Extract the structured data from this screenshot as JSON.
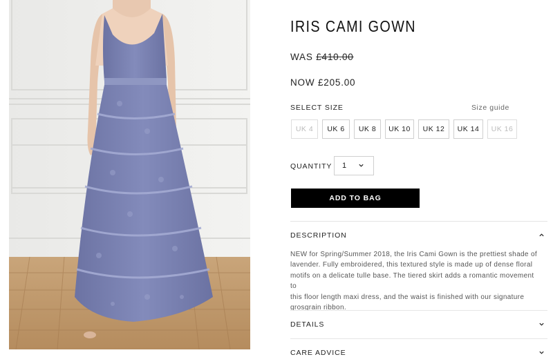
{
  "product": {
    "title": "IRIS CAMI GOWN",
    "was_label": "WAS",
    "was_price": "£410.00",
    "now_label": "NOW",
    "now_price": "£205.00",
    "image_alt": "Iris Cami Gown lavender tiered tulle maxi dress"
  },
  "size_selector": {
    "label": "SELECT SIZE",
    "guide_link": "Size guide",
    "options": [
      {
        "label": "UK 4",
        "available": false
      },
      {
        "label": "UK 6",
        "available": true
      },
      {
        "label": "UK 8",
        "available": true
      },
      {
        "label": "UK 10",
        "available": true
      },
      {
        "label": "UK 12",
        "available": true
      },
      {
        "label": "UK 14",
        "available": true
      },
      {
        "label": "UK 16",
        "available": false
      }
    ]
  },
  "quantity": {
    "label": "QUANTITY",
    "value": "1"
  },
  "add_to_bag": "ADD TO BAG",
  "accordion": {
    "description": {
      "title": "DESCRIPTION",
      "expanded": true,
      "lines": [
        "NEW for Spring/Summer 2018, the Iris Cami Gown is the prettiest shade of",
        "lavender. Fully embroidered, this textured style is made up of dense floral",
        "motifs on a delicate tulle base. The tiered skirt adds a romantic movement to",
        "this floor length maxi dress, and the waist is finished with our signature",
        "grosgrain ribbon."
      ]
    },
    "details": {
      "title": "DETAILS",
      "expanded": false
    },
    "care": {
      "title": "CARE ADVICE",
      "expanded": false
    }
  },
  "colors": {
    "dress": "#7a82b0",
    "button_bg": "#000000",
    "border": "#cfcfcf"
  },
  "icons": {
    "chevron_down": "chevron-down-icon",
    "chevron_up": "chevron-up-icon"
  }
}
